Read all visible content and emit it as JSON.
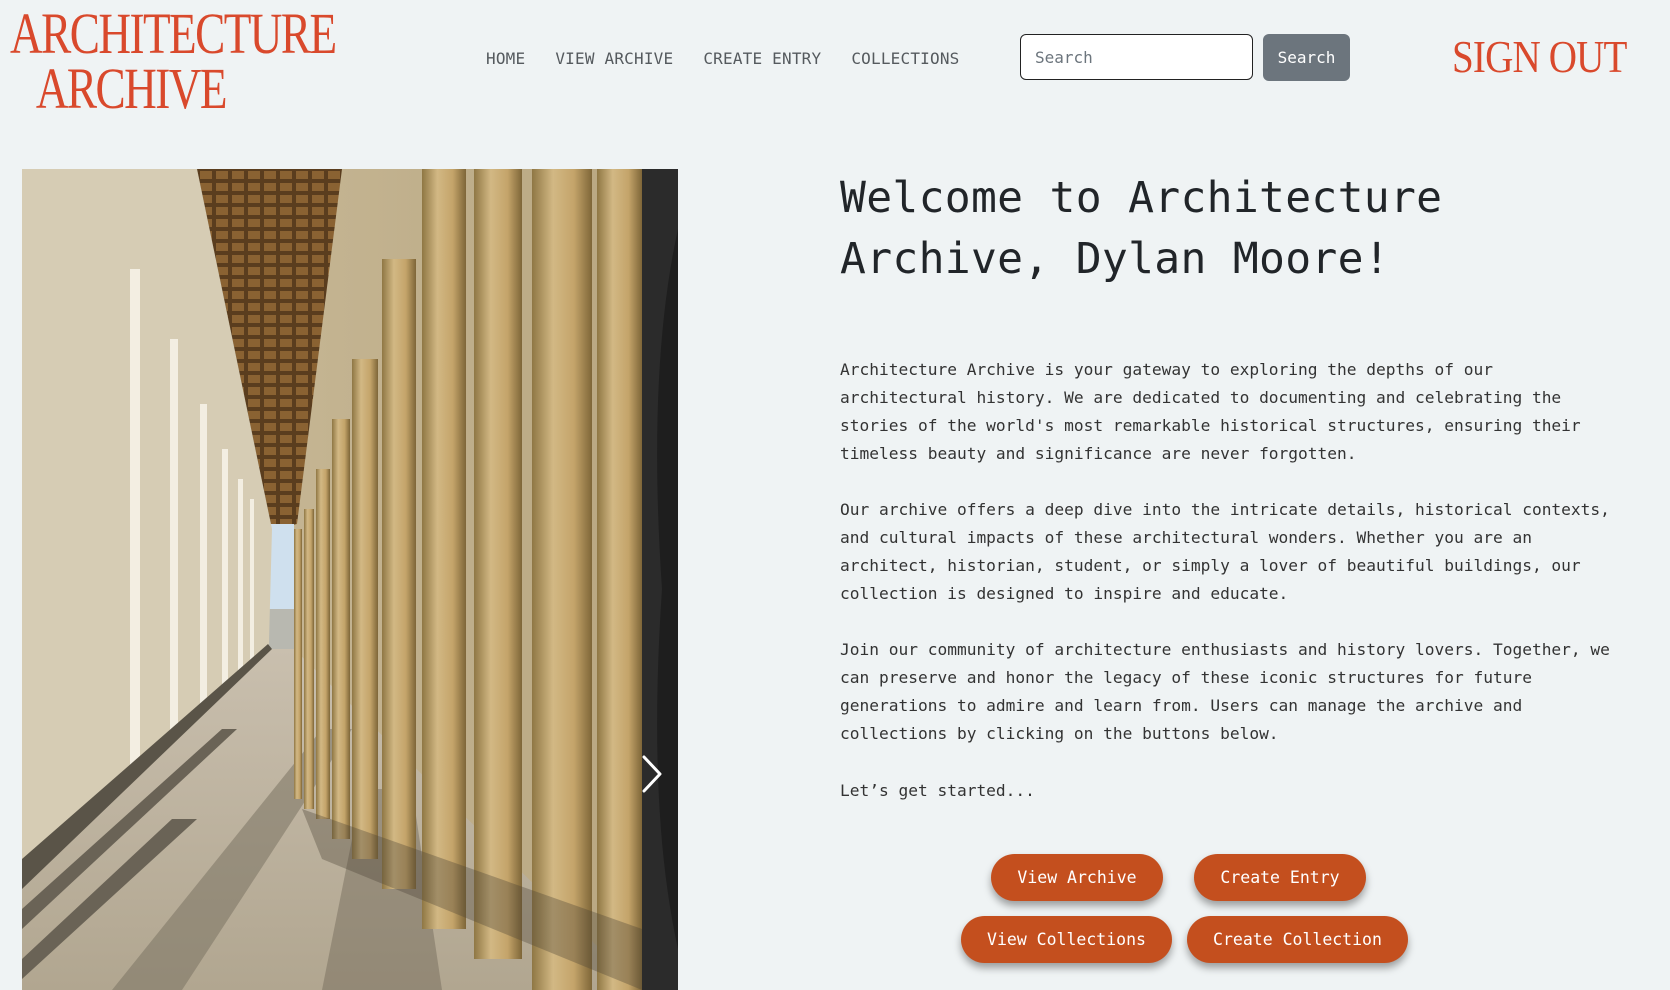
{
  "header": {
    "logo_line1": "ARCHITECTURE",
    "logo_line2": "ARCHIVE",
    "nav": [
      "HOME",
      "VIEW ARCHIVE",
      "CREATE ENTRY",
      "COLLECTIONS"
    ],
    "search_placeholder": "Search",
    "search_button": "Search",
    "sign_out": "SIGN OUT"
  },
  "hero": {
    "image_alt": "Colonnade with tall stone columns",
    "next_icon": "chevron-right-icon"
  },
  "main": {
    "welcome": "Welcome to Architecture Archive, Dylan Moore!",
    "paragraphs": [
      "Architecture Archive is your gateway to exploring the depths of our architectural history. We are dedicated to documenting and celebrating the stories of the world's most remarkable historical structures, ensuring their timeless beauty and significance are never forgotten.",
      "Our archive offers a deep dive into the intricate details, historical contexts, and cultural impacts of these architectural wonders. Whether you are an architect, historian, student, or simply a lover of beautiful buildings, our collection is designed to inspire and educate.",
      "Join our community of architecture enthusiasts and history lovers. Together, we can preserve and honor the legacy of these iconic structures for future generations to admire and learn from. Users can manage the archive and collections by clicking on the buttons below.",
      "Let’s get started..."
    ],
    "buttons": {
      "view_archive": "View Archive",
      "create_entry": "Create Entry",
      "view_collections": "View Collections",
      "create_collection": "Create Collection"
    }
  },
  "colors": {
    "accent": "#d9492c",
    "button": "#c44f1e",
    "search_button": "#6c757d",
    "background": "#eff3f4"
  }
}
